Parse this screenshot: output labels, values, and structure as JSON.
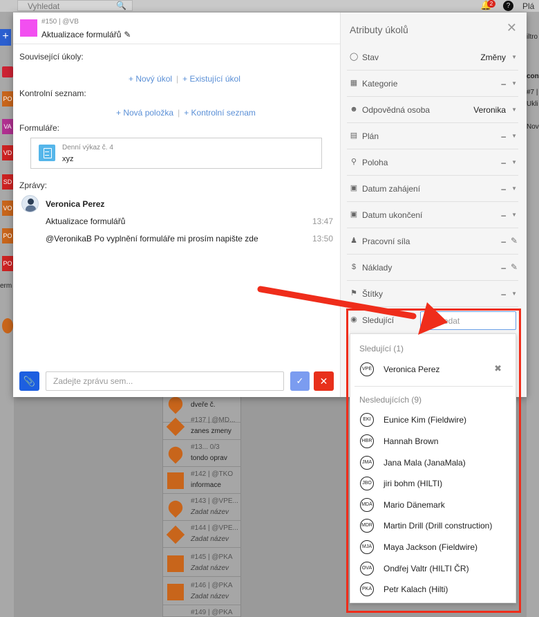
{
  "background": {
    "search_placeholder": "Vyhledat",
    "notification_count": "2",
    "right_label": "Plá",
    "right_bits": [
      "iltro",
      "cont",
      "#7 |",
      "Ukli",
      "Nov"
    ],
    "left_labels": [
      "PO",
      "VA",
      "VD",
      "SD",
      "VO",
      "PO",
      "PO"
    ],
    "left_word": "erm",
    "cards": [
      {
        "meta": "",
        "name": "dveře č."
      },
      {
        "meta": "#137 | @MD...",
        "name": "zanes zmeny"
      },
      {
        "meta": "#13...  0/3",
        "name": "tondo oprav"
      },
      {
        "meta": "#142 | @TKO",
        "name": "informace"
      },
      {
        "meta": "#143 | @VPE...",
        "name": "Zadat název"
      },
      {
        "meta": "#144 | @VPE...",
        "name": "Zadat název"
      },
      {
        "meta": "#145 | @PKA",
        "name": "Zadat název"
      },
      {
        "meta": "#146 | @PKA",
        "name": "Zadat název"
      },
      {
        "meta": "#149 | @PKA",
        "name": ""
      }
    ]
  },
  "task": {
    "meta": "#150 | @VB",
    "title": "Aktualizace formulářů",
    "color": "#f24ff0"
  },
  "sections": {
    "related_tasks": "Související úkoly:",
    "new_task": "+ Nový úkol",
    "existing_task": "+ Existující úkol",
    "checklist": "Kontrolní seznam:",
    "new_item": "+ Nová položka",
    "checklist_link": "+ Kontrolní seznam",
    "forms": "Formuláře:",
    "messages": "Zprávy:"
  },
  "form": {
    "meta": "Denní výkaz č. 4",
    "name": "xyz"
  },
  "messages": {
    "author": "Veronica Perez",
    "items": [
      {
        "text": "Aktualizace formulářů",
        "time": "13:47"
      },
      {
        "text": "@VeronikaB Po vyplnění formuláře mi prosím napište zde",
        "time": "13:50"
      }
    ]
  },
  "composer": {
    "placeholder": "Zadejte zprávu sem..."
  },
  "attributes": {
    "title": "Atributy úkolů",
    "rows": [
      {
        "label": "Stav",
        "value": "Změny",
        "icon": "check-circle-icon"
      },
      {
        "label": "Kategorie",
        "value": "–",
        "icon": "grid-icon"
      },
      {
        "label": "Odpovědná osoba",
        "value": "Veronika",
        "icon": "person-icon"
      },
      {
        "label": "Plán",
        "value": "–",
        "icon": "map-icon"
      },
      {
        "label": "Poloha",
        "value": "–",
        "icon": "location-pin-icon"
      },
      {
        "label": "Datum zahájení",
        "value": "–",
        "icon": "calendar-icon"
      },
      {
        "label": "Datum ukončení",
        "value": "–",
        "icon": "calendar-icon"
      },
      {
        "label": "Pracovní síla",
        "value": "–",
        "icon": "people-icon"
      },
      {
        "label": "Náklady",
        "value": "–",
        "icon": "dollar-icon"
      },
      {
        "label": "Štítky",
        "value": "–",
        "icon": "tag-icon"
      },
      {
        "label": "Sledující",
        "value": "",
        "icon": "eye-icon"
      }
    ],
    "watch_placeholder": "Vyhledat"
  },
  "watchers": {
    "following_heading": "Sledující (1)",
    "following": [
      {
        "initials": "VPE",
        "name": "Veronica Perez"
      }
    ],
    "not_following_heading": "Nesledujících (9)",
    "not_following": [
      {
        "initials": "EKI",
        "name": "Eunice Kim (Fieldwire)"
      },
      {
        "initials": "HBR",
        "name": "Hannah Brown"
      },
      {
        "initials": "JMA",
        "name": "Jana Mala (JanaMala)"
      },
      {
        "initials": "JBO",
        "name": "jiri bohm (HILTI)"
      },
      {
        "initials": "MDÄ",
        "name": "Mario Dänemark"
      },
      {
        "initials": "MDR",
        "name": "Martin Drill (Drill construction)"
      },
      {
        "initials": "MJA",
        "name": "Maya Jackson (Fieldwire)"
      },
      {
        "initials": "OVA",
        "name": "Ondřej Valtr (HILTI ČR)"
      },
      {
        "initials": "PKA",
        "name": "Petr Kalach (Hilti)"
      }
    ]
  },
  "colors": {
    "accent_blue": "#1d5fe0",
    "link_blue": "#5a8fd6",
    "annotation_red": "#ef2d1b",
    "task_pink": "#f24ff0",
    "marker_orange": "#c8651b"
  }
}
